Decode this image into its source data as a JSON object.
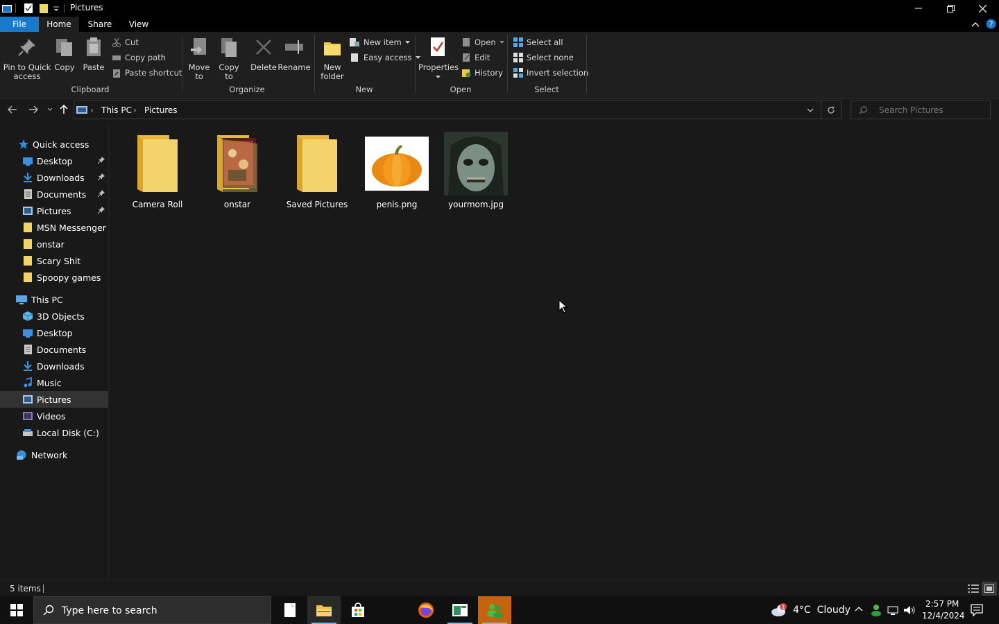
{
  "window": {
    "title": "Pictures",
    "accent": "#1979ca"
  },
  "tabs": [
    {
      "label": "File"
    },
    {
      "label": "Home"
    },
    {
      "label": "Share"
    },
    {
      "label": "View"
    }
  ],
  "ribbon": {
    "clipboard": {
      "label": "Clipboard",
      "pin": "Pin to Quick",
      "pin2": "access",
      "copy": "Copy",
      "paste": "Paste",
      "cut": "Cut",
      "copy_path": "Copy path",
      "paste_shortcut": "Paste shortcut"
    },
    "organize": {
      "label": "Organize",
      "move": "Move",
      "move2": "to",
      "copy_to": "Copy",
      "copy_to2": "to",
      "delete": "Delete",
      "rename": "Rename"
    },
    "new": {
      "label": "New",
      "new_folder": "New",
      "new_folder2": "folder",
      "new_item": "New item",
      "easy_access": "Easy access"
    },
    "open": {
      "label": "Open",
      "properties": "Properties",
      "open": "Open",
      "edit": "Edit",
      "history": "History"
    },
    "select": {
      "label": "Select",
      "select_all": "Select all",
      "select_none": "Select none",
      "invert": "Invert selection"
    }
  },
  "address": {
    "crumbs": [
      "This PC",
      "Pictures"
    ],
    "search_placeholder": "Search Pictures"
  },
  "nav": {
    "quick_access": "Quick access",
    "quick_items": [
      {
        "label": "Desktop",
        "icon": "desktop-icon"
      },
      {
        "label": "Downloads",
        "icon": "downloads-icon"
      },
      {
        "label": "Documents",
        "icon": "documents-icon"
      },
      {
        "label": "Pictures",
        "icon": "pictures-icon"
      },
      {
        "label": "MSN Messenger",
        "icon": "folder-icon"
      },
      {
        "label": "onstar",
        "icon": "folder-icon"
      },
      {
        "label": "Scary Shit",
        "icon": "folder-icon"
      },
      {
        "label": "Spoopy games",
        "icon": "folder-icon"
      }
    ],
    "this_pc": "This PC",
    "pc_items": [
      {
        "label": "3D Objects",
        "icon": "3d-objects-icon"
      },
      {
        "label": "Desktop",
        "icon": "desktop-icon"
      },
      {
        "label": "Documents",
        "icon": "documents-icon"
      },
      {
        "label": "Downloads",
        "icon": "downloads-icon"
      },
      {
        "label": "Music",
        "icon": "music-icon"
      },
      {
        "label": "Pictures",
        "icon": "pictures-icon"
      },
      {
        "label": "Videos",
        "icon": "videos-icon"
      },
      {
        "label": "Local Disk (C:)",
        "icon": "disk-icon"
      }
    ],
    "network": "Network"
  },
  "files": [
    {
      "name": "Camera Roll",
      "type": "folder"
    },
    {
      "name": "onstar",
      "type": "folder-with-image"
    },
    {
      "name": "Saved Pictures",
      "type": "folder"
    },
    {
      "name": "penis.png",
      "type": "image-pumpkin"
    },
    {
      "name": "yourmom.jpg",
      "type": "image-face"
    }
  ],
  "status": {
    "items": "5 items"
  },
  "taskbar": {
    "search_placeholder": "Type here to search",
    "weather": "4°C  Cloudy",
    "weather_badge": "1",
    "time": "2:57 PM",
    "date": "12/4/2024"
  }
}
